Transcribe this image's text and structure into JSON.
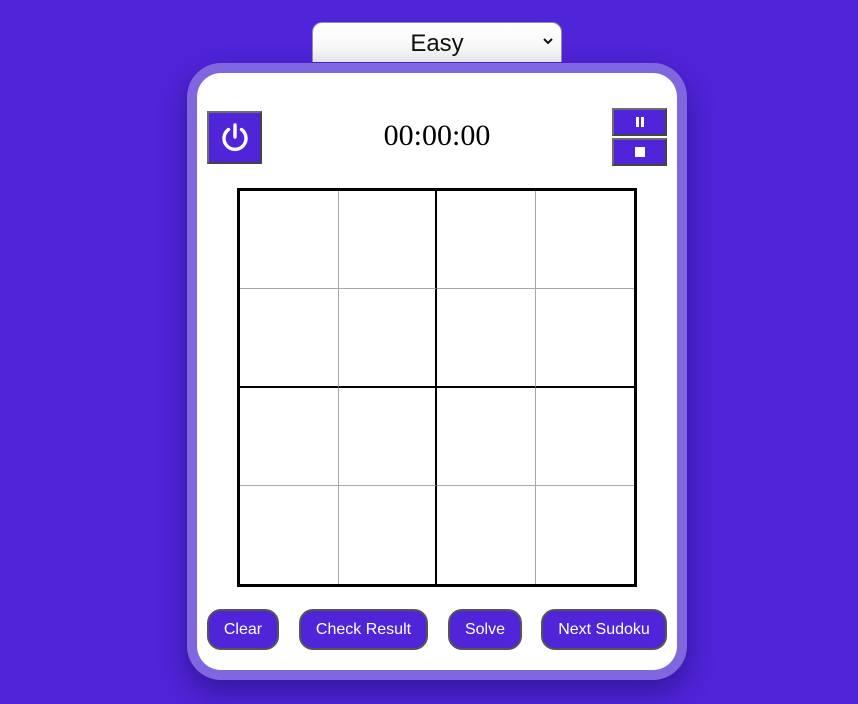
{
  "difficulty": {
    "selected": "Easy"
  },
  "timer": {
    "value": "00:00:00"
  },
  "controls": {
    "power_icon": "power-icon",
    "pause_icon": "pause-icon",
    "stop_icon": "stop-icon"
  },
  "board": {
    "size": 4,
    "cells": [
      "",
      "",
      "",
      "",
      "",
      "",
      "",
      "",
      "",
      "",
      "",
      "",
      "",
      "",
      "",
      ""
    ]
  },
  "actions": {
    "clear": "Clear",
    "check": "Check Result",
    "solve": "Solve",
    "next": "Next Sudoku"
  },
  "colors": {
    "background": "#5024d9",
    "card_border": "#8066df",
    "button": "#5024d9",
    "button_text": "#ffffff"
  }
}
